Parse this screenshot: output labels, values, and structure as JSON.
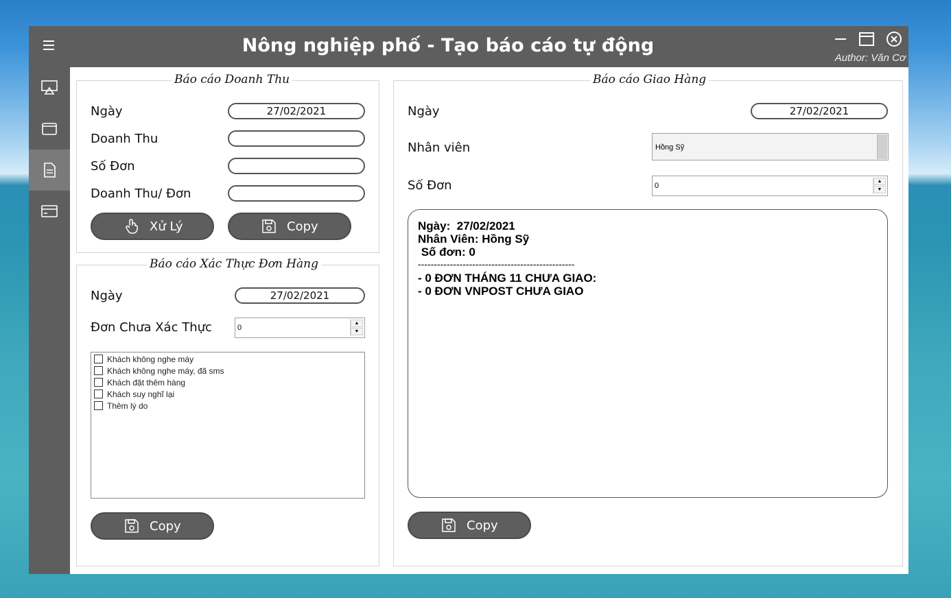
{
  "window": {
    "title": "Nông nghiệp phố - Tạo báo cáo tự động",
    "author": "Author: Văn Cơ"
  },
  "sidebar": {
    "items": [
      {
        "name": "airplay-icon"
      },
      {
        "name": "wallet-icon"
      },
      {
        "name": "document-icon",
        "active": true
      },
      {
        "name": "card-icon"
      }
    ]
  },
  "revenue": {
    "legend": "Báo cáo Doanh Thu",
    "date_label": "Ngày",
    "date_value": "27/02/2021",
    "revenue_label": "Doanh Thu",
    "revenue_value": "",
    "orders_label": "Số Đơn",
    "orders_value": "",
    "per_order_label": "Doanh Thu/ Đơn",
    "per_order_value": "",
    "process_button": "Xử Lý",
    "copy_button": "Copy"
  },
  "verify": {
    "legend": "Báo cáo Xác Thực Đơn Hàng",
    "date_label": "Ngày",
    "date_value": "27/02/2021",
    "unverified_label": "Đơn Chưa Xác Thực",
    "unverified_value": "0",
    "reasons": [
      {
        "label": "Khách không nghe máy",
        "checked": false
      },
      {
        "label": "Khách không nghe máy, đã sms",
        "checked": false
      },
      {
        "label": "Khách đặt thêm hàng",
        "checked": false
      },
      {
        "label": "Khách suy nghĩ lại",
        "checked": false
      },
      {
        "label": "Thêm lý do",
        "checked": false
      }
    ],
    "copy_button": "Copy"
  },
  "delivery": {
    "legend": "Báo cáo Giao Hàng",
    "date_label": "Ngày",
    "date_value": "27/02/2021",
    "staff_label": "Nhân viên",
    "staff_value": "Hồng Sỹ",
    "orders_label": "Số Đơn",
    "orders_value": "0",
    "report_lines": [
      "Ngày:  27/02/2021",
      "Nhân Viên: Hồng Sỹ",
      " Số đơn: 0",
      "-------------------------------------------------",
      "- 0 ĐƠN THÁNG 11 CHƯA GIAO:",
      "- 0 ĐƠN VNPOST CHƯA GIAO"
    ],
    "copy_button": "Copy"
  },
  "colors": {
    "chrome": "#5e5e5e",
    "active_nav": "#7a7a7a",
    "button": "#5e5e5e"
  }
}
